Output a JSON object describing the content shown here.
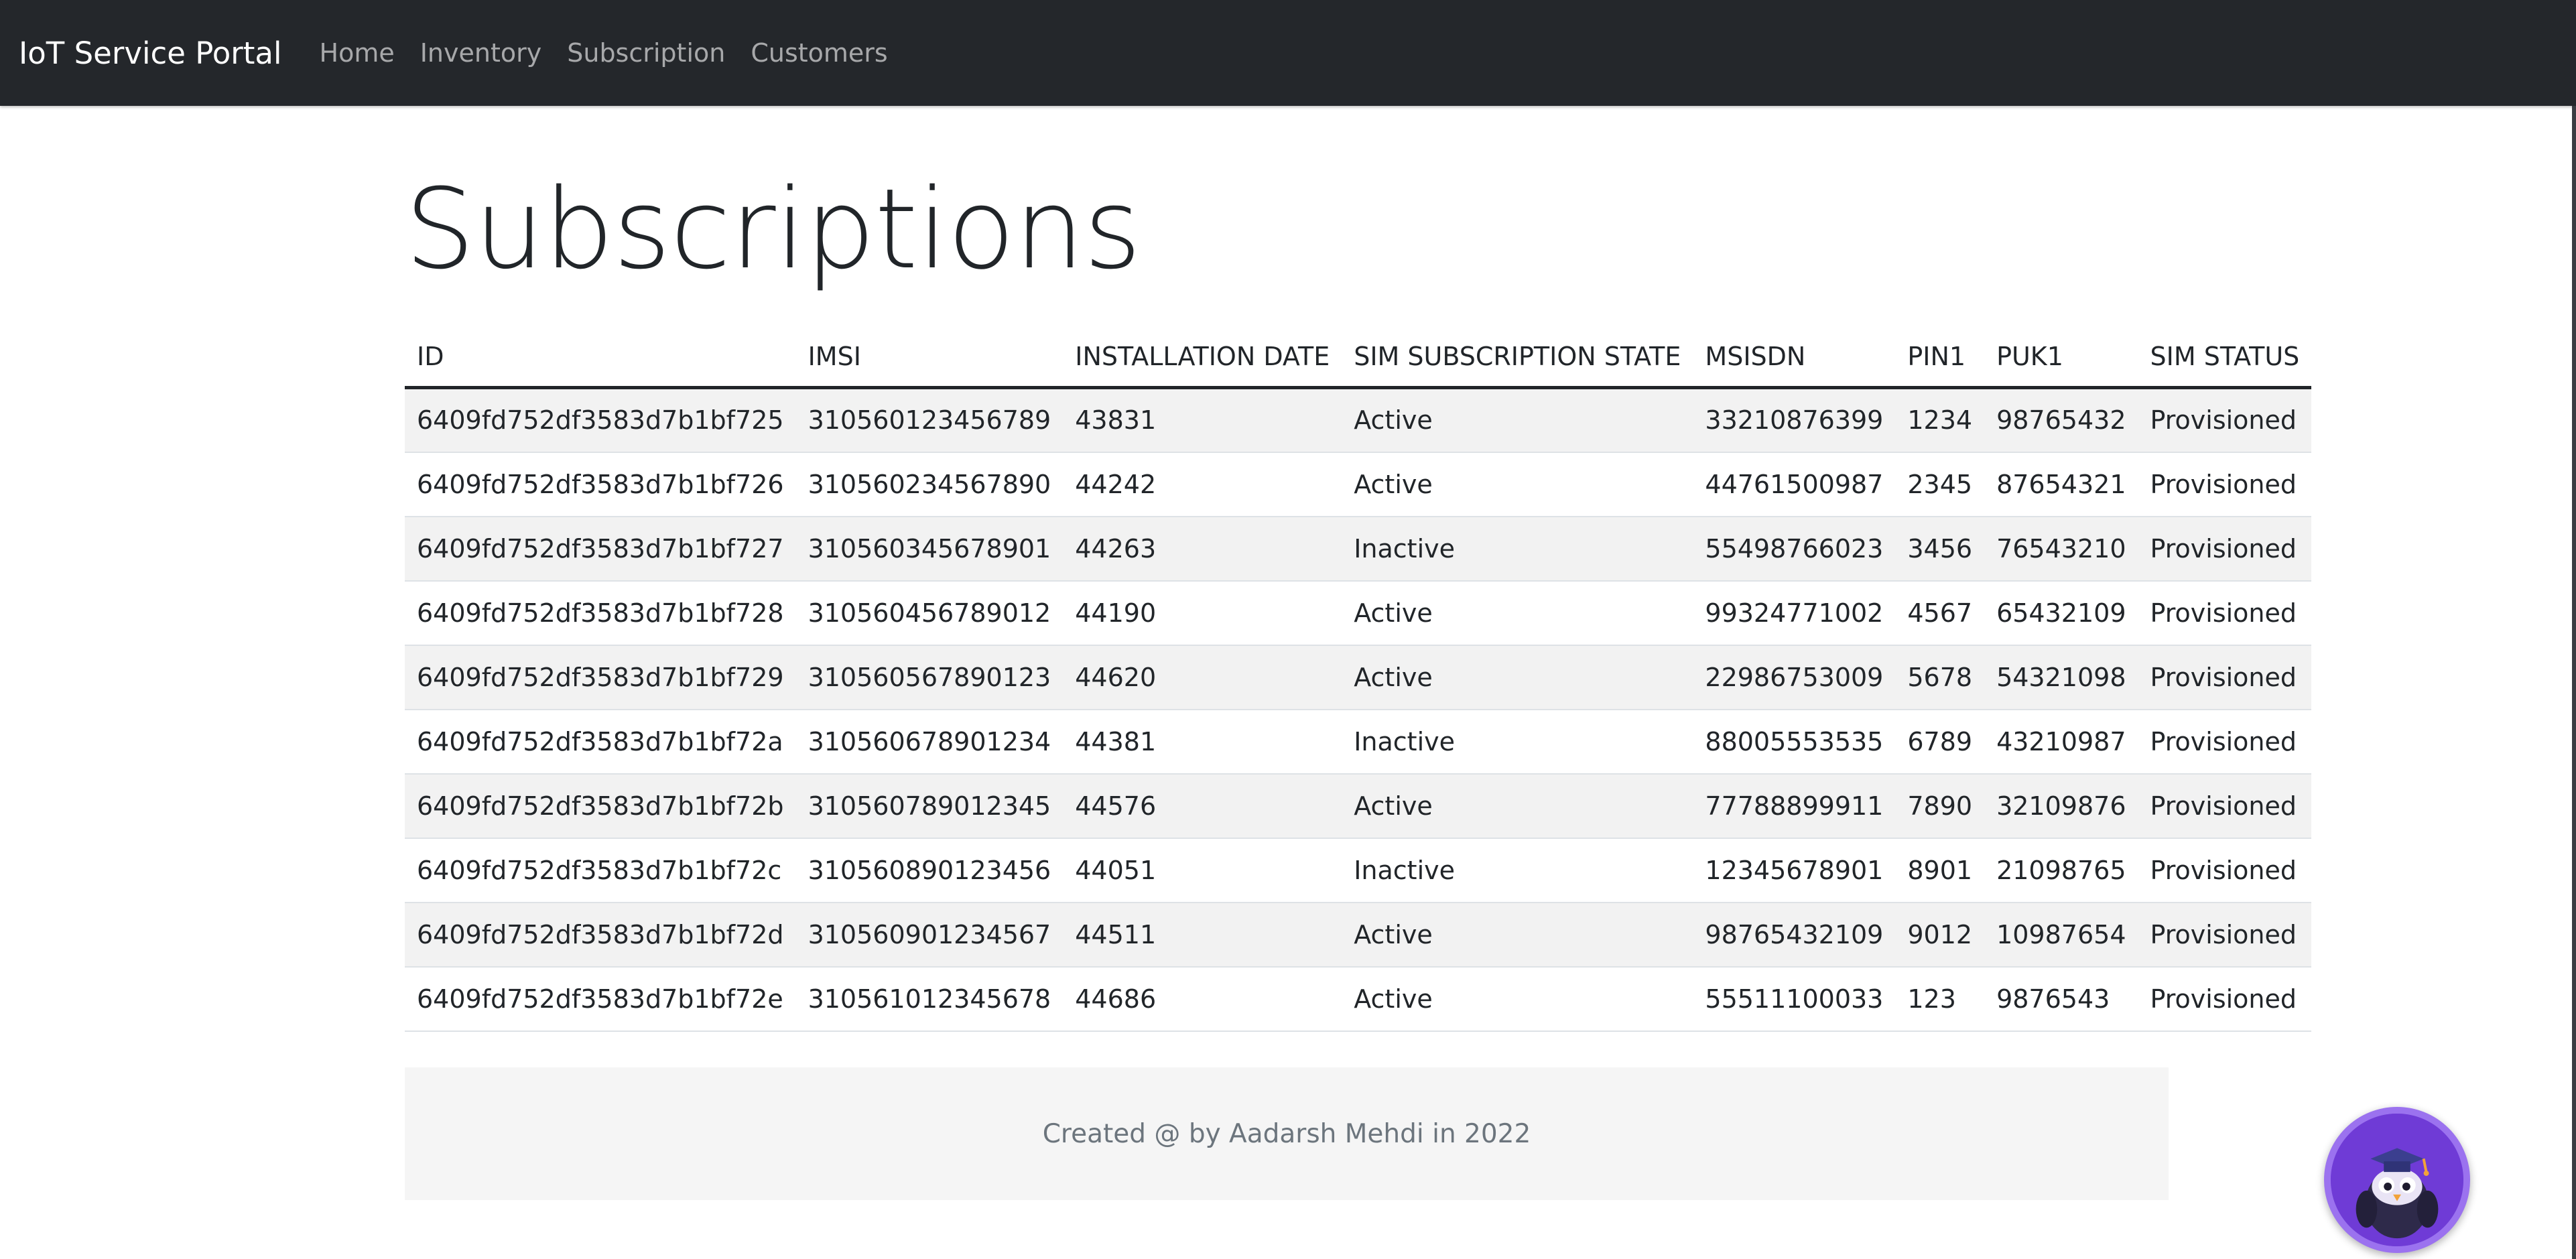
{
  "navbar": {
    "brand": "IoT Service Portal",
    "links": [
      "Home",
      "Inventory",
      "Subscription",
      "Customers"
    ]
  },
  "page": {
    "title": "Subscriptions"
  },
  "table": {
    "columns": [
      "ID",
      "IMSI",
      "INSTALLATION DATE",
      "SIM SUBSCRIPTION STATE",
      "MSISDN",
      "PIN1",
      "PUK1",
      "SIM STATUS"
    ],
    "rows": [
      [
        "6409fd752df3583d7b1bf725",
        "310560123456789",
        "43831",
        "Active",
        "33210876399",
        "1234",
        "98765432",
        "Provisioned"
      ],
      [
        "6409fd752df3583d7b1bf726",
        "310560234567890",
        "44242",
        "Active",
        "44761500987",
        "2345",
        "87654321",
        "Provisioned"
      ],
      [
        "6409fd752df3583d7b1bf727",
        "310560345678901",
        "44263",
        "Inactive",
        "55498766023",
        "3456",
        "76543210",
        "Provisioned"
      ],
      [
        "6409fd752df3583d7b1bf728",
        "310560456789012",
        "44190",
        "Active",
        "99324771002",
        "4567",
        "65432109",
        "Provisioned"
      ],
      [
        "6409fd752df3583d7b1bf729",
        "310560567890123",
        "44620",
        "Active",
        "22986753009",
        "5678",
        "54321098",
        "Provisioned"
      ],
      [
        "6409fd752df3583d7b1bf72a",
        "310560678901234",
        "44381",
        "Inactive",
        "88005553535",
        "6789",
        "43210987",
        "Provisioned"
      ],
      [
        "6409fd752df3583d7b1bf72b",
        "310560789012345",
        "44576",
        "Active",
        "77788899911",
        "7890",
        "32109876",
        "Provisioned"
      ],
      [
        "6409fd752df3583d7b1bf72c",
        "310560890123456",
        "44051",
        "Inactive",
        "12345678901",
        "8901",
        "21098765",
        "Provisioned"
      ],
      [
        "6409fd752df3583d7b1bf72d",
        "310560901234567",
        "44511",
        "Active",
        "98765432109",
        "9012",
        "10987654",
        "Provisioned"
      ],
      [
        "6409fd752df3583d7b1bf72e",
        "310561012345678",
        "44686",
        "Active",
        "55511100033",
        "123",
        "9876543",
        "Provisioned"
      ]
    ]
  },
  "footer": {
    "text": "Created @ by Aadarsh Mehdi in 2022"
  },
  "assistant": {
    "icon": "owl-mascot-icon"
  },
  "colors": {
    "navbar_bg": "#24272b",
    "stripe": "#f2f2f2",
    "footer_bg": "#f5f5f5",
    "assistant_bg": "#6f3bd6"
  }
}
